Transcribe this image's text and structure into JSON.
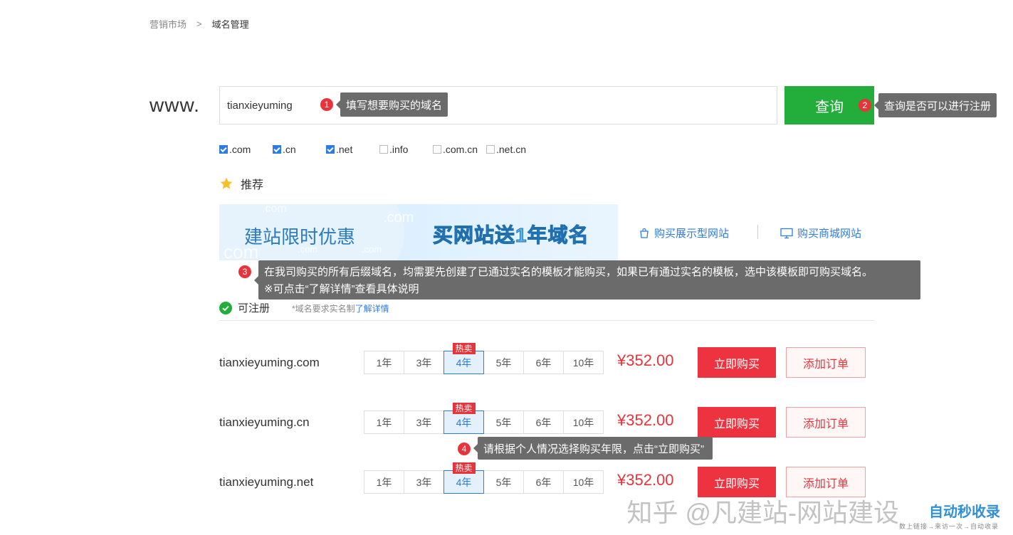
{
  "breadcrumb": {
    "parent": "营销市场",
    "sep": ">",
    "current": "域名管理"
  },
  "search": {
    "prefix": "www.",
    "value": "tianxieyuming",
    "button": "查询"
  },
  "tips": {
    "t1": {
      "num": "1",
      "text": "填写想要购买的域名"
    },
    "t2": {
      "num": "2",
      "text": "查询是否可以进行注册"
    },
    "t3": {
      "num": "3",
      "line1": "在我司购买的所有后缀域名，均需要先创建了已通过实名的模板才能购买，如果已有通过实名的模板，选中该模板即可购买域名。",
      "line2": "※可点击“了解详情”查看具体说明"
    },
    "t4": {
      "num": "4",
      "text": "请根据个人情况选择购买年限，点击“立即购买”"
    }
  },
  "suffixes": [
    {
      "label": ".com",
      "checked": true
    },
    {
      "label": ".cn",
      "checked": true
    },
    {
      "label": ".net",
      "checked": true
    },
    {
      "label": ".info",
      "checked": false
    },
    {
      "label": ".com.cn",
      "checked": false
    },
    {
      "label": ".net.cn",
      "checked": false
    }
  ],
  "recommend": {
    "label": "推荐"
  },
  "banner": {
    "left_text": "建站限时优惠",
    "right_text": "买网站送1年域名",
    "ghost_com": ".com",
    "ghost_word": "com"
  },
  "links": {
    "showcase": "购买展示型网站",
    "mall": "购买商城网站"
  },
  "availability": {
    "status": "可注册",
    "note": "*域名要求实名制",
    "link": "了解详情"
  },
  "year_options": [
    "1年",
    "3年",
    "4年",
    "5年",
    "6年",
    "10年"
  ],
  "hot_label": "热卖",
  "domains": [
    {
      "name": "tianxieyuming.com",
      "selected_year": "4年",
      "price": "¥352.00",
      "buy": "立即购买",
      "order": "添加订单"
    },
    {
      "name": "tianxieyuming.cn",
      "selected_year": "4年",
      "price": "¥352.00",
      "buy": "立即购买",
      "order": "添加订单"
    },
    {
      "name": "tianxieyuming.net",
      "selected_year": "4年",
      "price": "¥352.00",
      "buy": "立即购买",
      "order": "添加订单"
    }
  ],
  "watermark": {
    "text": "知乎 @凡建站-网站建设",
    "logo": "自动秒收录",
    "sub": "数上链接→来访一次→自动收录"
  },
  "colors": {
    "green": "#23ad3a",
    "red": "#e8333b",
    "blue": "#2d7be5",
    "tip_bg": "#6b6b6b"
  }
}
